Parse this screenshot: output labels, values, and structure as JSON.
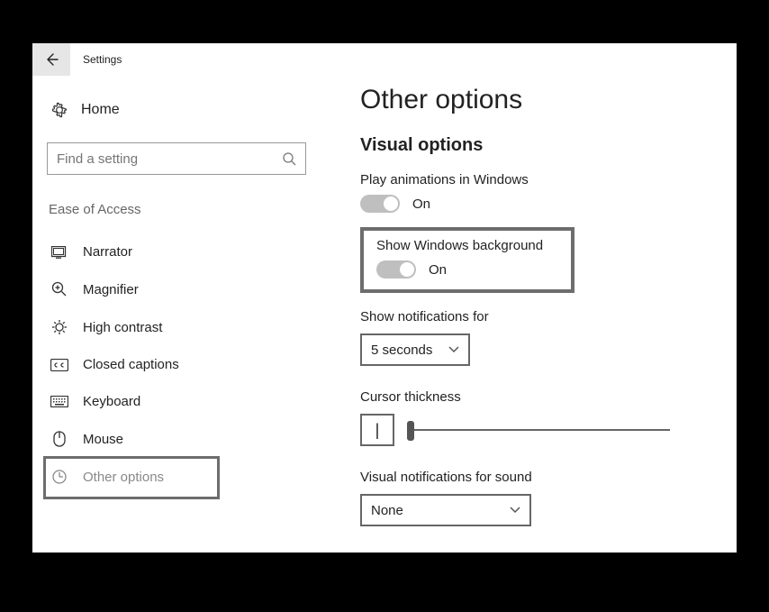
{
  "titlebar": {
    "title": "Settings"
  },
  "sidebar": {
    "home_label": "Home",
    "search_placeholder": "Find a setting",
    "category": "Ease of Access",
    "items": [
      {
        "label": "Narrator"
      },
      {
        "label": "Magnifier"
      },
      {
        "label": "High contrast"
      },
      {
        "label": "Closed captions"
      },
      {
        "label": "Keyboard"
      },
      {
        "label": "Mouse"
      },
      {
        "label": "Other options"
      }
    ]
  },
  "main": {
    "title": "Other options",
    "section1": "Visual options",
    "play_animations": {
      "label": "Play animations in Windows",
      "state": "On"
    },
    "show_background": {
      "label": "Show Windows background",
      "state": "On"
    },
    "show_notifications": {
      "label": "Show notifications for",
      "value": "5 seconds"
    },
    "cursor_thickness": {
      "label": "Cursor thickness",
      "preview": "|"
    },
    "visual_notifications": {
      "label": "Visual notifications for sound",
      "value": "None"
    }
  }
}
